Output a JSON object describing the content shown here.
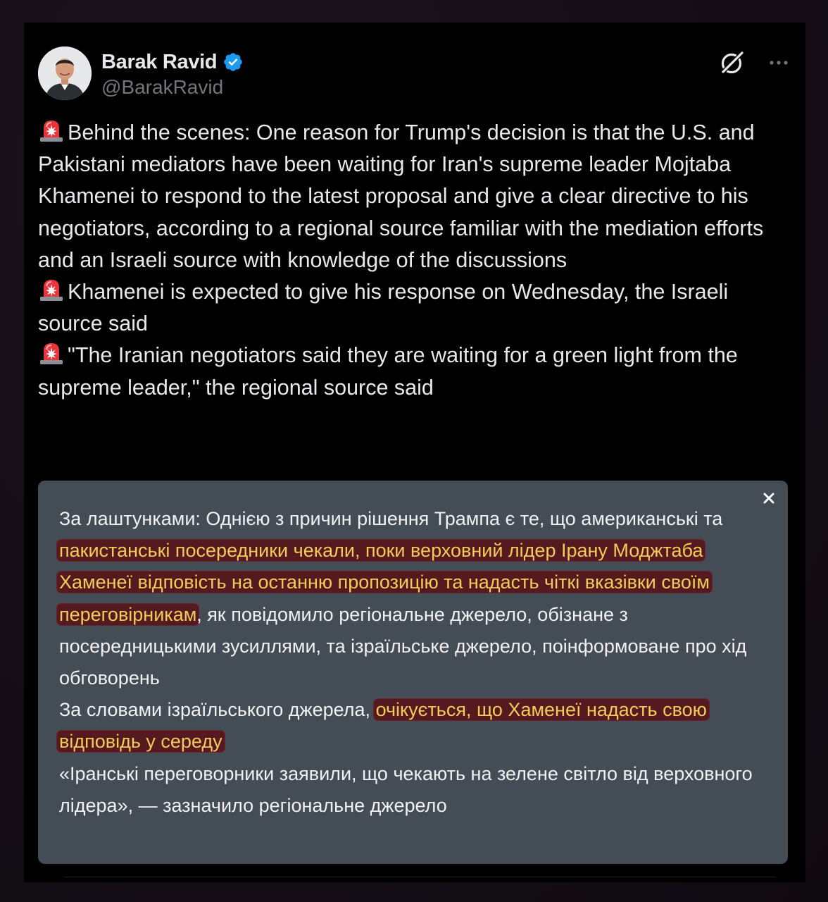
{
  "author": {
    "name": "Barak Ravid",
    "handle": "@BarakRavid",
    "verified": true
  },
  "icons": {
    "verified": "verified-badge-icon",
    "grok": "grok-icon",
    "more": "more-options-icon",
    "siren": "siren-emoji-icon",
    "close": "close-icon"
  },
  "colors": {
    "background": "#000000",
    "text": "#e7e9ea",
    "handle": "#71767b",
    "verified": "#1d9bf0",
    "translation_bg": "#444d55",
    "highlight_bg": "#541a20",
    "highlight_text": "#f3cc57"
  },
  "tweet": {
    "p1": "Behind the scenes: One reason for Trump's decision is that the U.S. and Pakistani mediators have been waiting for Iran's supreme leader Mojtaba Khamenei to respond to the latest proposal and give a clear directive to his negotiators, according to a regional source familiar with the mediation efforts and an Israeli source with knowledge of the discussions",
    "p2": "Khamenei is expected to give his response on Wednesday, the Israeli source said",
    "p3": "\"The Iranian negotiators said they are waiting for a green light from the supreme leader,\" the regional source said"
  },
  "translation": {
    "p1_a": "За лаштунками: Однією з причин рішення Трампа є те, що американські та ",
    "p1_hl": "пакистанські посередники чекали, поки верховний лідер Ірану Моджтаба Хаменеї відповість на останню пропозицію та надасть чіткі вказівки своїм переговірникам",
    "p1_b": ", як повідомило регіональне джерело, обізнане з посередницькими зусиллями, та ізраїльське джерело, поінформоване про хід обговорень",
    "p2_a": "За словами ізраїльського джерела, ",
    "p2_hl": "очікується, що Хаменеї надасть свою відповідь у середу",
    "p3": " «Іранські переговорники заявили, що чекають на зелене світло від верховного лідера», — зазначило регіональне джерело"
  }
}
